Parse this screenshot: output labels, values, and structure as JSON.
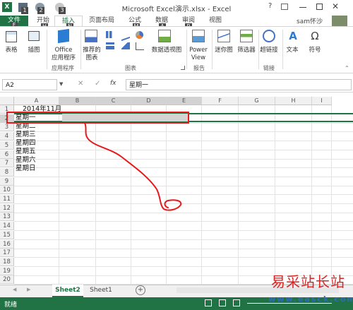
{
  "window": {
    "title": "Microsoft Excel演示.xlsx - Excel",
    "help": "?",
    "user": "sam怀沙",
    "keytips": [
      "1",
      "2",
      "3"
    ]
  },
  "tabs": {
    "file": "文件",
    "home": "开始",
    "insert": "插入",
    "layout": "页面布局",
    "formulas": "公式",
    "data": "数据",
    "review": "审阅",
    "view": "视图",
    "keytip_file": "F",
    "keytip_home": "H",
    "keytip_insert": "N",
    "keytip_layout": "P",
    "keytip_formulas": "M",
    "keytip_data": "A",
    "keytip_review": "R",
    "keytip_view": "W"
  },
  "ribbon": {
    "table": "表格",
    "illustrations": "插图",
    "office_app": "Office",
    "office_app2": "应用程序",
    "recommended_charts": "推荐的",
    "recommended_charts2": "图表",
    "pivot_chart": "数据透视图",
    "power_view": "Power",
    "power_view2": "View",
    "sparklines": "迷你图",
    "filter": "筛选器",
    "hyperlink": "超链接",
    "text": "文本",
    "symbol": "符号",
    "group_apps": "应用程序",
    "group_charts": "图表",
    "group_reports": "报告",
    "group_links": "链接"
  },
  "formula_bar": {
    "name_box": "A2",
    "fx": "fx",
    "content": "星期一"
  },
  "columns": [
    "A",
    "B",
    "C",
    "D",
    "E",
    "F",
    "G",
    "H",
    "I"
  ],
  "rows": [
    "1",
    "2",
    "3",
    "4",
    "5",
    "6",
    "7",
    "8",
    "9",
    "10",
    "11",
    "12",
    "13",
    "14",
    "15",
    "16",
    "17",
    "18",
    "19",
    "20"
  ],
  "cells": {
    "a1": "2014年11月",
    "a2": "星期一",
    "a3": "星期二",
    "a4": "星期三",
    "a5": "星期四",
    "a6": "星期五",
    "a7": "星期六",
    "a8": "星期日"
  },
  "sheets": {
    "active": "Sheet2",
    "other": "Sheet1",
    "add": "+"
  },
  "status": {
    "ready": "就绪"
  },
  "watermark": {
    "name": "易采站长站",
    "url": "www.easck.com"
  },
  "colors": {
    "excel_green": "#217346",
    "selection_red": "#e8191d"
  }
}
